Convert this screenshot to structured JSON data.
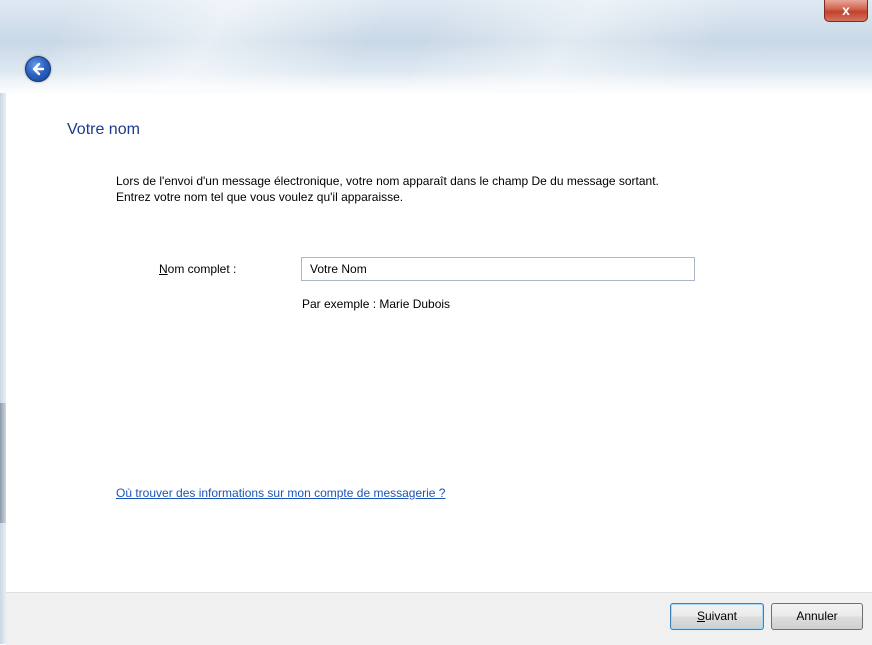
{
  "titlebar": {
    "close_label": "x"
  },
  "heading": "Votre nom",
  "description": {
    "line1": "Lors de l'envoi d'un message électronique, votre nom apparaît dans le champ De du message sortant.",
    "line2": "Entrez votre nom tel que vous voulez qu'il apparaisse."
  },
  "form": {
    "label_accesskey": "N",
    "label_rest": "om complet :",
    "value": "Votre Nom",
    "example": "Par exemple : Marie Dubois"
  },
  "help_link": "Où trouver des informations sur mon compte de messagerie ?",
  "buttons": {
    "next_accesskey": "S",
    "next_rest": "uivant",
    "cancel": "Annuler"
  },
  "icons": {
    "back": "back-arrow-icon",
    "close": "close-icon"
  }
}
